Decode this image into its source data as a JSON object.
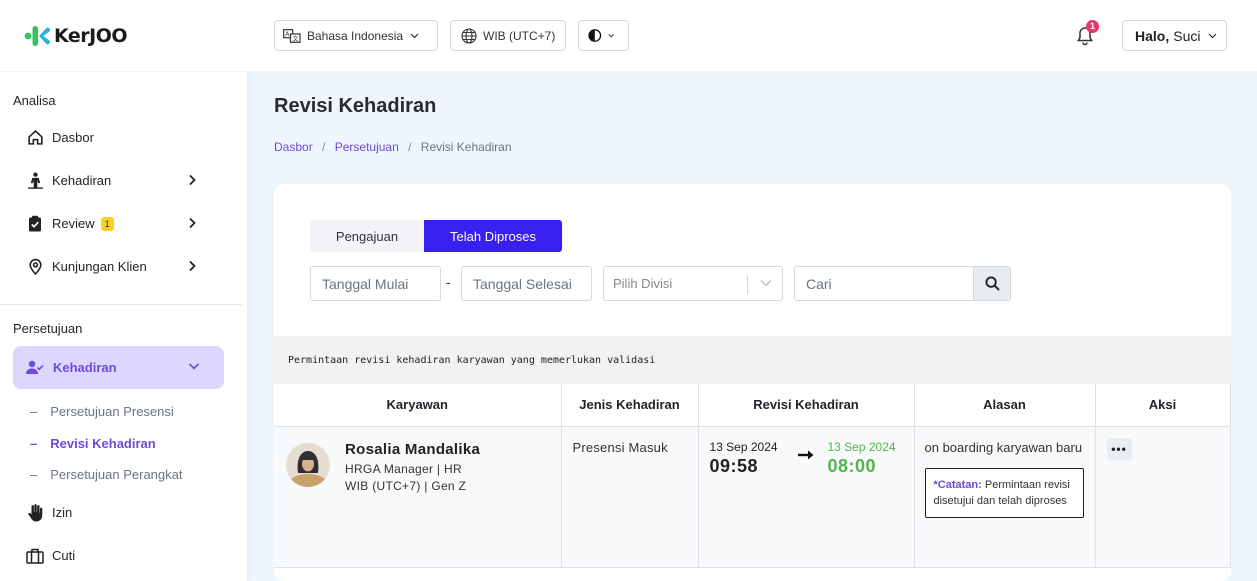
{
  "app": {
    "logo_text": "KerJOO"
  },
  "sidebar": {
    "analisa_title": "Analisa",
    "analisa_items": [
      {
        "label": "Dasbor",
        "icon": "home-icon"
      },
      {
        "label": "Kehadiran",
        "icon": "person-standing-icon"
      },
      {
        "label": "Review",
        "icon": "clipboard-check-icon",
        "badge": "1"
      },
      {
        "label": "Kunjungan Klien",
        "icon": "map-pin-icon"
      }
    ],
    "persetujuan_title": "Persetujuan",
    "active_group": {
      "label": "Kehadiran",
      "icon": "user-check-icon"
    },
    "sub_items": [
      {
        "label": "Persetujuan Presensi"
      },
      {
        "label": "Revisi Kehadiran"
      },
      {
        "label": "Persetujuan Perangkat"
      }
    ],
    "other_items": [
      {
        "label": "Izin",
        "icon": "hand-icon"
      },
      {
        "label": "Cuti",
        "icon": "briefcase-icon"
      }
    ]
  },
  "topbar": {
    "language": "Bahasa Indonesia",
    "timezone": "WIB (UTC+7)",
    "notif_count": "1",
    "greeting": "Halo,",
    "user_name": "Suci"
  },
  "page": {
    "title": "Revisi Kehadiran",
    "breadcrumb": [
      "Dasbor",
      "Persetujuan",
      "Revisi Kehadiran"
    ],
    "breadcrumb_sep": "/"
  },
  "tabs": [
    "Pengajuan",
    "Telah Diproses"
  ],
  "filters": {
    "start_date": "Tanggal Mulai",
    "date_sep": "-",
    "end_date": "Tanggal Selesai",
    "division": "Pilih Divisi",
    "search": "Cari"
  },
  "info_text": "Permintaan revisi kehadiran karyawan yang memerlukan validasi",
  "table": {
    "headers": [
      "Karyawan",
      "Jenis Kehadiran",
      "Revisi Kehadiran",
      "Alasan",
      "Aksi"
    ],
    "rows": [
      {
        "name": "Rosalia Mandalika",
        "role": "HRGA Manager | HR",
        "zone": "WIB (UTC+7) | Gen Z",
        "jenis": "Presensi Masuk",
        "old_date": "13 Sep 2024",
        "old_time": "09:58",
        "new_date": "13 Sep 2024",
        "new_time": "08:00",
        "alasan": "on boarding karyawan baru",
        "catatan_label": "*Catatan:",
        "catatan_text": "Permintaan revisi disetujui dan telah diproses",
        "aksi": "•••"
      }
    ]
  },
  "colors": {
    "accent": "#6d4bd9",
    "tab_active": "#3a1ff1",
    "new_time": "#52b44d",
    "badge": "#fad02c"
  }
}
